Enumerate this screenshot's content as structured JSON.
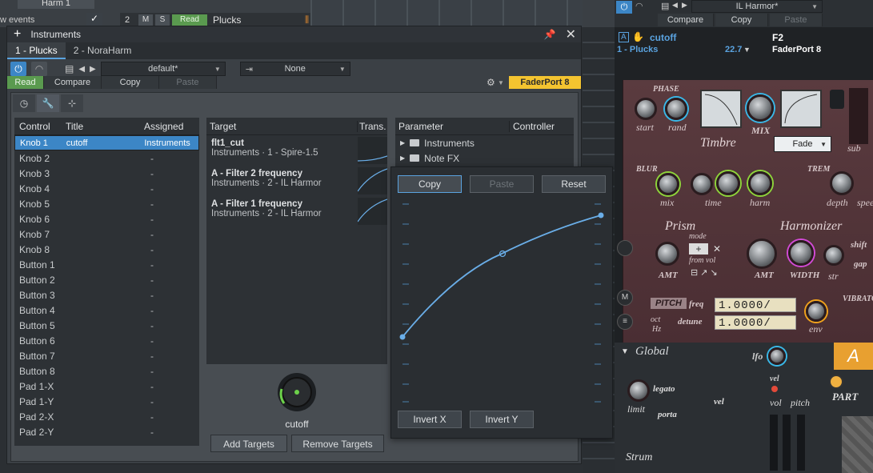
{
  "daw": {
    "track_menu_label": "Harm 1",
    "show_events_label": "w events",
    "track_number": "2",
    "mute_label": "M",
    "solo_label": "S",
    "read_label": "Read",
    "track_name": "Plucks"
  },
  "panel": {
    "plus": "+",
    "title": "Instruments",
    "tabs": [
      "1 - Plucks",
      "2 - NoraHarm"
    ],
    "preset": "default*",
    "none_select": "None",
    "read": "Read",
    "compare": "Compare",
    "copy": "Copy",
    "paste": "Paste",
    "faderport": "FaderPort 8"
  },
  "list": {
    "headers": [
      "Control",
      "Title",
      "Assigned"
    ],
    "rows": [
      [
        "Knob 1",
        "cutoff",
        "Instruments"
      ],
      [
        "Knob 2",
        "",
        "-"
      ],
      [
        "Knob 3",
        "",
        "-"
      ],
      [
        "Knob 4",
        "",
        "-"
      ],
      [
        "Knob 5",
        "",
        "-"
      ],
      [
        "Knob 6",
        "",
        "-"
      ],
      [
        "Knob 7",
        "",
        "-"
      ],
      [
        "Knob 8",
        "",
        "-"
      ],
      [
        "Button 1",
        "",
        "-"
      ],
      [
        "Button 2",
        "",
        "-"
      ],
      [
        "Button 3",
        "",
        "-"
      ],
      [
        "Button 4",
        "",
        "-"
      ],
      [
        "Button 5",
        "",
        "-"
      ],
      [
        "Button 6",
        "",
        "-"
      ],
      [
        "Button 7",
        "",
        "-"
      ],
      [
        "Button 8",
        "",
        "-"
      ],
      [
        "Pad 1-X",
        "",
        "-"
      ],
      [
        "Pad 1-Y",
        "",
        "-"
      ],
      [
        "Pad 2-X",
        "",
        "-"
      ],
      [
        "Pad 2-Y",
        "",
        "-"
      ]
    ]
  },
  "targets": {
    "headers": [
      "Target",
      "Trans."
    ],
    "items": [
      {
        "name": "flt1_cut",
        "source": "Instruments · 1 - Spire-1.5"
      },
      {
        "name": "A - Filter 2 frequency",
        "source": "Instruments · 2 - IL Harmor"
      },
      {
        "name": "A - Filter 1 frequency",
        "source": "Instruments · 2 - IL Harmor"
      }
    ],
    "knob_label": "cutoff",
    "add": "Add Targets",
    "remove": "Remove Targets"
  },
  "params": {
    "headers": [
      "Parameter",
      "Controller"
    ],
    "items": [
      "Instruments",
      "Note FX"
    ]
  },
  "curve_popup": {
    "copy": "Copy",
    "paste": "Paste",
    "reset": "Reset",
    "invert_x": "Invert X",
    "invert_y": "Invert Y"
  },
  "right": {
    "preset": "IL Harmor*",
    "compare": "Compare",
    "copy": "Copy",
    "paste": "Paste",
    "control_name": "cutoff",
    "control_track": "1 - Plucks",
    "value": "22.7",
    "key": "F2",
    "device": "FaderPort 8"
  },
  "plugin": {
    "phase": "PHASE",
    "start": "start",
    "rand": "rand",
    "mix": "MIX",
    "timbre": "Timbre",
    "fade": "Fade",
    "sub": "sub",
    "blur": "BLUR",
    "blur_mix": "mix",
    "time": "time",
    "harm": "harm",
    "trem": "TREM",
    "depth": "depth",
    "speed": "spee",
    "prism": "Prism",
    "mode": "mode",
    "from_vol": "from vol",
    "amt": "AMT",
    "harmonizer": "Harmonizer",
    "h_amt": "AMT",
    "width": "WIDTH",
    "str": "str",
    "shift": "shift",
    "gap": "gap",
    "pitch": "PITCH",
    "freq": "freq",
    "detune": "detune",
    "oct": "oct",
    "hz": "Hz",
    "lcd1": "1.0000/",
    "lcd2": "1.0000/",
    "env": "env",
    "vibrato": "VIBRATO",
    "global": "Global",
    "lfo": "lfo",
    "legato": "legato",
    "vel": "vel",
    "vel2": "vel",
    "limit": "limit",
    "porta": "porta",
    "vol": "vol",
    "pitch2": "pitch",
    "part": "PART",
    "part_letter": "A",
    "strum": "Strum"
  },
  "colors": {
    "accent_blue": "#3c86c6",
    "read_green": "#5a9a4f",
    "faderport_yellow": "#f4c430",
    "curve_blue": "#6aaee8"
  }
}
